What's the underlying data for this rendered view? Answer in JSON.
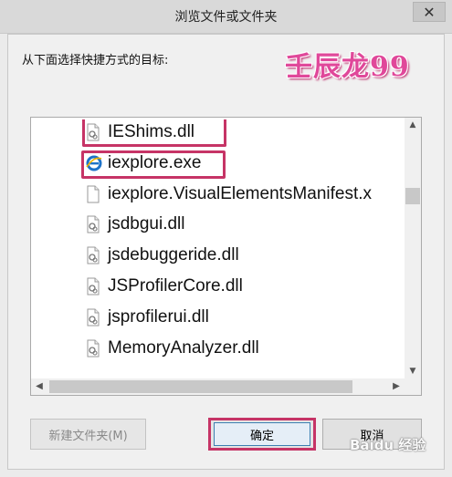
{
  "window": {
    "title": "浏览文件或文件夹",
    "close_glyph": "✕"
  },
  "prompt": "从下面选择快捷方式的目标:",
  "watermark": "壬辰龙99",
  "files": [
    {
      "name": "IEShims.dll",
      "icon": "dll-file-icon"
    },
    {
      "name": "iexplore.exe",
      "icon": "internet-explorer-icon"
    },
    {
      "name": "iexplore.VisualElementsManifest.x",
      "icon": "blank-file-icon"
    },
    {
      "name": "jsdbgui.dll",
      "icon": "dll-file-icon"
    },
    {
      "name": "jsdebuggeride.dll",
      "icon": "dll-file-icon"
    },
    {
      "name": "JSProfilerCore.dll",
      "icon": "dll-file-icon"
    },
    {
      "name": "jsprofilerui.dll",
      "icon": "dll-file-icon"
    },
    {
      "name": "MemoryAnalyzer.dll",
      "icon": "dll-file-icon"
    }
  ],
  "buttons": {
    "new_folder": "新建文件夹(M)",
    "ok": "确定",
    "cancel": "取消"
  },
  "overlay": {
    "baidu": "Baidu 经验"
  },
  "colors": {
    "highlight": "#c63466",
    "watermark": "#e0489a",
    "ie_blue": "#1e73c8"
  }
}
